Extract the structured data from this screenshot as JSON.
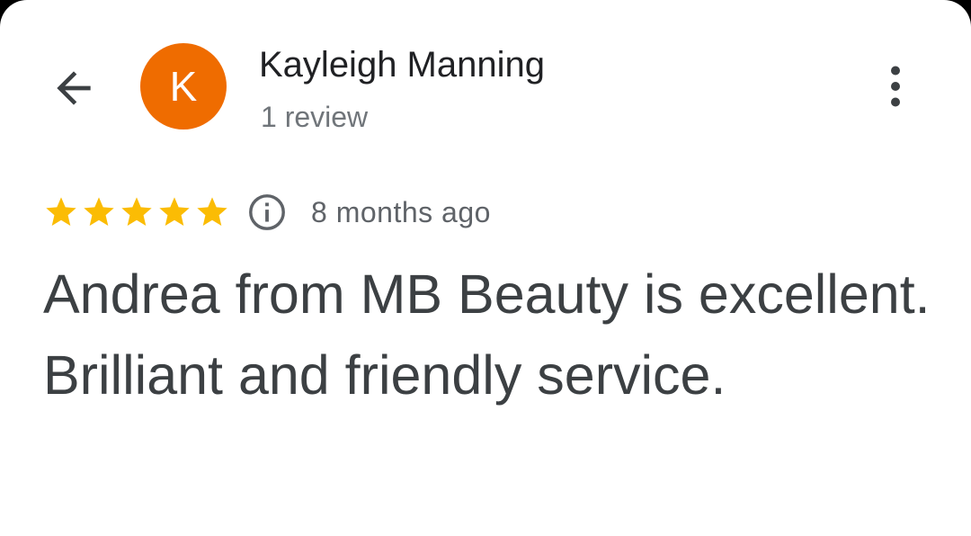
{
  "review": {
    "author_name": "Kayleigh Manning",
    "author_initial": "K",
    "review_count": "1 review",
    "rating": 5,
    "rating_max": 5,
    "time_ago": "8 months ago",
    "text": "Andrea from MB Beauty is excellent. Brilliant and friendly service."
  },
  "icons": {
    "back": "back-arrow-icon",
    "more": "more-vert-icon",
    "info": "info-icon",
    "star": "star-icon"
  },
  "colors": {
    "avatar_bg": "#ef6c00",
    "star": "#fbbc04",
    "text_primary": "#202124",
    "text_body": "#3c4043",
    "text_secondary": "#70757a"
  }
}
